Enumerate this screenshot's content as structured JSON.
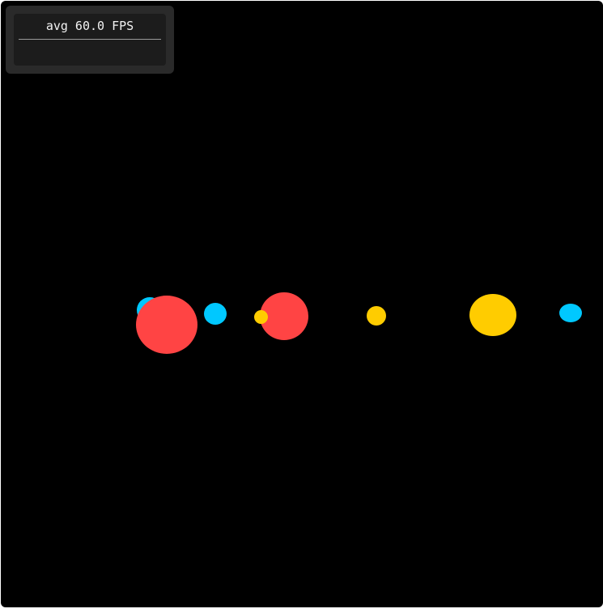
{
  "fps_meter": {
    "label": "avg 60.0 FPS"
  },
  "scene": {
    "background_color": "#000000",
    "ball_colors": {
      "red": "#ff4444",
      "blue": "#00c8ff",
      "yellow": "#ffcc00"
    }
  }
}
